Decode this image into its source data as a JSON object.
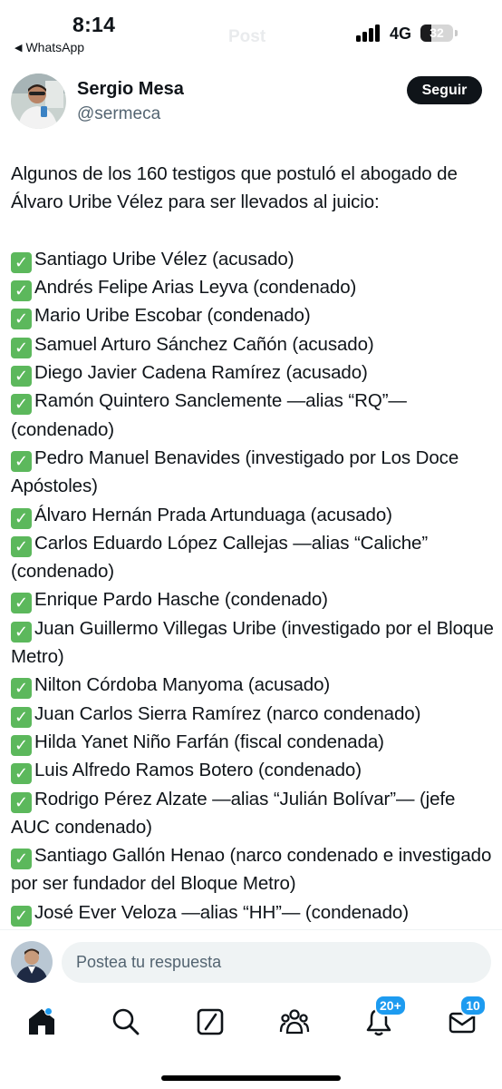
{
  "status_bar": {
    "time": "8:14",
    "back_app": "WhatsApp",
    "network": "4G",
    "battery": "32",
    "battery_level": 0.32
  },
  "header": {
    "ghost_title": "Post"
  },
  "author": {
    "display_name": "Sergio Mesa",
    "handle": "@sermeca",
    "follow_label": "Seguir"
  },
  "post": {
    "intro": "Algunos de los 160 testigos que postuló el abogado de Álvaro Uribe Vélez para ser llevados al juicio:",
    "check_symbol": "✓",
    "witnesses": [
      "Santiago Uribe Vélez (acusado)",
      "Andrés Felipe Arias Leyva (condenado)",
      "Mario Uribe Escobar (condenado)",
      "Samuel Arturo Sánchez Cañón (acusado)",
      "Diego Javier Cadena Ramírez (acusado)",
      "Ramón Quintero Sanclemente —alias “RQ”— (condenado)",
      "Pedro Manuel Benavides (investigado por Los Doce Apóstoles)",
      "Álvaro Hernán Prada Artunduaga (acusado)",
      "Carlos Eduardo López Callejas —alias “Caliche” (condenado)",
      "Enrique Pardo Hasche (condenado)",
      "Juan Guillermo Villegas Uribe (investigado por el Bloque Metro)",
      "Nilton Córdoba Manyoma (acusado)",
      "Juan Carlos Sierra Ramírez (narco condenado)",
      "Hilda Yanet Niño Farfán (fiscal condenada)",
      "Luis Alfredo Ramos Botero (condenado)",
      "Rodrigo Pérez Alzate —alias “Julián Bolívar”— (jefe AUC condenado)",
      "Santiago Gallón Henao (narco condenado e investigado por ser fundador del Bloque Metro)",
      "José Ever Veloza —alias “HH”— (condenado)"
    ]
  },
  "reply": {
    "placeholder": "Postea tu respuesta"
  },
  "nav": {
    "notifications_badge": "20+",
    "messages_badge": "10",
    "icons": [
      "home-icon",
      "search-icon",
      "grok-icon",
      "communities-icon",
      "notifications-icon",
      "messages-icon"
    ]
  },
  "colors": {
    "text": "#0f1419",
    "secondary_text": "#536471",
    "accent": "#1d9bf0",
    "check_green": "#5cb85c",
    "input_bg": "#eff3f4"
  }
}
